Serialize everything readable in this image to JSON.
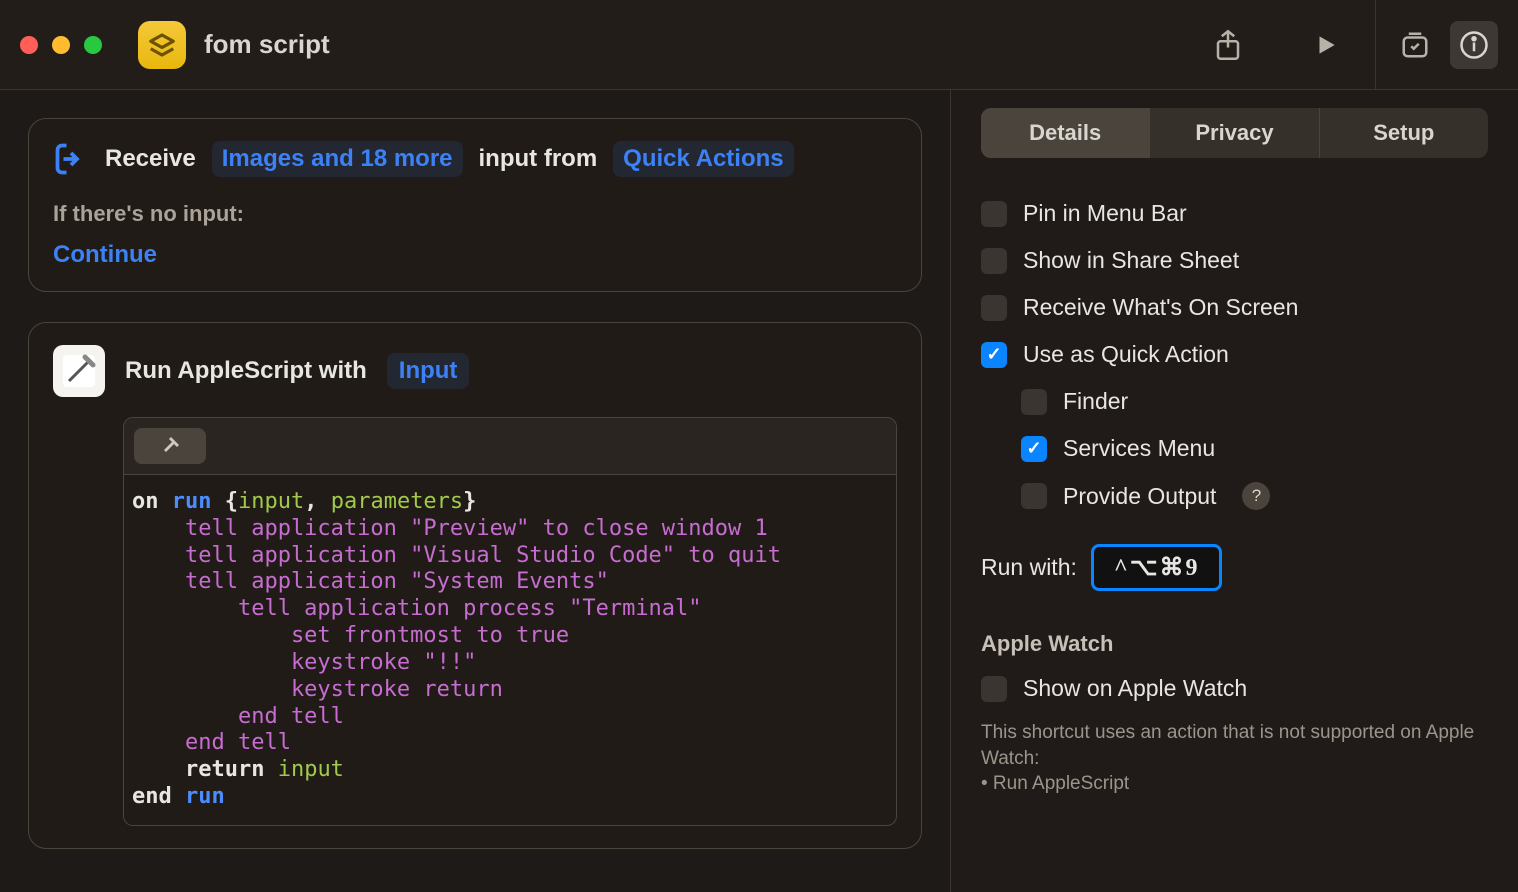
{
  "window": {
    "title": "fom script"
  },
  "input_block": {
    "receive_label": "Receive",
    "types_token": "Images and 18 more",
    "from_label": "input from",
    "source_token": "Quick Actions",
    "noinput_label": "If there's no input:",
    "noinput_action": "Continue"
  },
  "action_block": {
    "title": "Run AppleScript with",
    "param": "Input"
  },
  "script": {
    "l1a": "on ",
    "l1b": "run ",
    "l1c": "{",
    "l1d": "input",
    "l1e": ", ",
    "l1f": "parameters",
    "l1g": "}",
    "l2": "    tell application \"Preview\" to close window 1",
    "l3": "    tell application \"Visual Studio Code\" to quit",
    "l4": "    tell application \"System Events\"",
    "l5": "        tell application process \"Terminal\"",
    "l6": "            set frontmost to true",
    "l7": "            keystroke \"!!\"",
    "l8": "            keystroke return",
    "l9": "        end tell",
    "l10": "    end tell",
    "l11a": "    return ",
    "l11b": "input",
    "l12a": "end ",
    "l12b": "run"
  },
  "sidebar": {
    "tabs": {
      "details": "Details",
      "privacy": "Privacy",
      "setup": "Setup"
    },
    "options": {
      "pin": "Pin in Menu Bar",
      "share": "Show in Share Sheet",
      "receive": "Receive What's On Screen",
      "quick": "Use as Quick Action",
      "finder": "Finder",
      "services": "Services Menu",
      "output": "Provide Output"
    },
    "runwith_label": "Run with:",
    "hotkey": "^⌥⌘9",
    "watch_header": "Apple Watch",
    "watch_show": "Show on Apple Watch",
    "watch_note": "This shortcut uses an action that is not supported on Apple Watch:",
    "watch_bullet": "• Run AppleScript"
  }
}
